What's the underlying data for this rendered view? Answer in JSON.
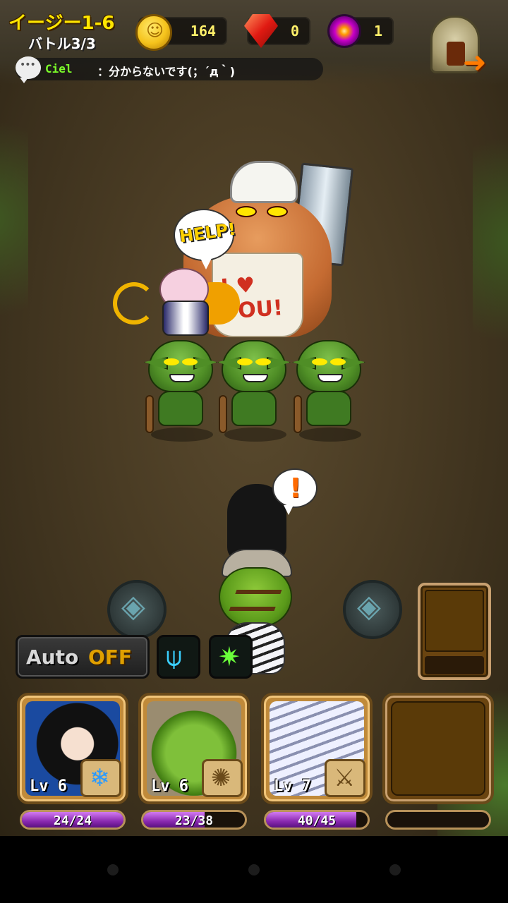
{
  "hud": {
    "stage_title": "イージー1-6",
    "battle_progress": "バトル3/3",
    "currencies": [
      {
        "name": "gold-coin",
        "value": "164"
      },
      {
        "name": "ruby",
        "value": "0"
      },
      {
        "name": "magic-orb",
        "value": "1"
      }
    ]
  },
  "chat": {
    "name": "Ciel",
    "message": "：分からないです(；´д｀)"
  },
  "scene": {
    "help_bubble": "HELP!",
    "alert_bubble": "!",
    "ogre_apron": "I ♥ POU!"
  },
  "controls": {
    "auto_label": "Auto",
    "auto_state": "OFF"
  },
  "party": [
    {
      "name": "kunoichi",
      "level": "Lv 6",
      "skill_icon": "ice-shard-icon",
      "hp_current": 24,
      "hp_max": 24,
      "hp_text": "24/24"
    },
    {
      "name": "orc-warrior",
      "level": "Lv 6",
      "skill_icon": "spike-burst-icon",
      "hp_current": 23,
      "hp_max": 38,
      "hp_text": "23/38"
    },
    {
      "name": "white-tiger",
      "level": "Lv 7",
      "skill_icon": "sword-ring-icon",
      "hp_current": 40,
      "hp_max": 45,
      "hp_text": "40/45"
    },
    {
      "name": "empty-slot",
      "level": "",
      "skill_icon": "",
      "hp_current": 0,
      "hp_max": 0,
      "hp_text": ""
    }
  ],
  "colors": {
    "accent_yellow": "#ffe600",
    "hp_purple": "#8a2ab0",
    "chat_name_green": "#7cff2a"
  }
}
